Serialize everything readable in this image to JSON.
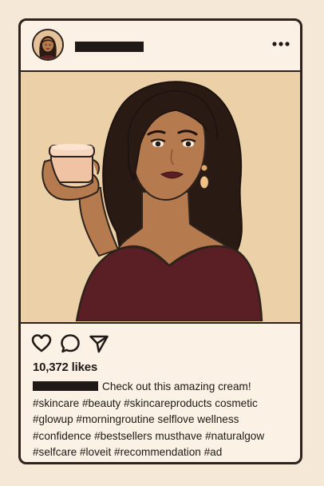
{
  "post": {
    "likes_text": "10,372 likes",
    "caption_text": "Check out this amazing cream!",
    "hashtag_lines": [
      "#skincare #beauty #skincareproducts cosmetic",
      "#glowup #morningroutine selflove wellness",
      "#confidence #bestsellers musthave #naturalgow",
      "#selfcare #loveit #recommendation #ad"
    ]
  },
  "icons": {
    "more": "more-horizontal-icon",
    "like": "heart-icon",
    "comment": "comment-bubble-icon",
    "share": "paper-plane-icon"
  },
  "colors": {
    "background": "#f5e8d6",
    "frame": "#fbf1e4",
    "outline": "#2d221c",
    "image_bg": "#ebd0a8",
    "dress": "#5a1f24",
    "skin": "#b57a4e",
    "hair": "#2a1a14",
    "jar": "#efc3a3"
  }
}
